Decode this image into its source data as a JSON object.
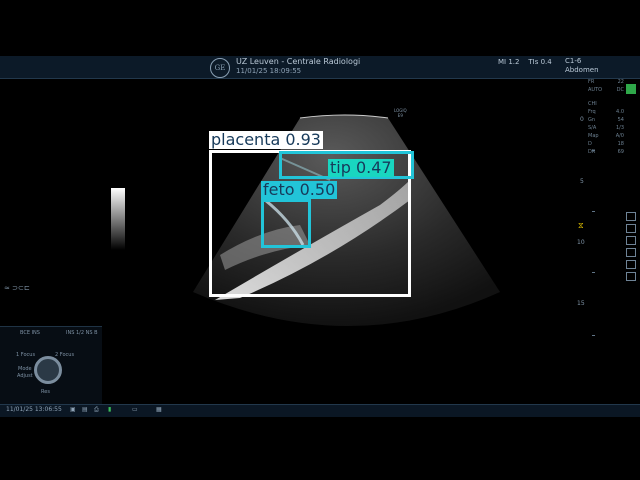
{
  "header": {
    "logo": "GE",
    "hospital": "UZ Leuven - Centrale Radiologi",
    "datetime": "11/01/25 18:09:55",
    "mi": "MI 1.2",
    "tis": "TIs 0.4",
    "probe": "C1-6",
    "preset": "Abdomen"
  },
  "right_panel": {
    "fr": [
      "FR",
      "22"
    ],
    "aut": [
      "AUTO",
      "DC"
    ],
    "mode": "CHI",
    "params": [
      [
        "Frq",
        "4.0"
      ],
      [
        "Gn",
        "54"
      ],
      [
        "S/A",
        "1/3"
      ],
      [
        "Map",
        "A/0"
      ],
      [
        "D",
        "18"
      ],
      [
        "DR",
        "69"
      ]
    ]
  },
  "depth_marks": [
    "0",
    "5",
    "10",
    "15"
  ],
  "focus_marker": "⧖",
  "probe_label": [
    "LOGIQ",
    "E9"
  ],
  "left_label": "≈ ⊃⊂⊏",
  "detections": [
    {
      "label": "placenta 0.93",
      "color": "#ffffff",
      "tag_bg": "#ffffff"
    },
    {
      "label": "tip 0.47",
      "color": "#22c4d8",
      "tag_bg": "#19d6c0"
    },
    {
      "label": "feto 0.50",
      "color": "#22c4d8",
      "tag_bg": "#22c4d8"
    }
  ],
  "bottom_panel": {
    "top_left": "BCE INS",
    "top_right": "INS 1/2 NS B",
    "focus_left": "1 Focus",
    "focus_right": "2 Focus",
    "mode_left": "Mode",
    "mode_left2": "Adjust",
    "center": "Res"
  },
  "statusbar": {
    "time": "11/01/25 13:06:55"
  }
}
